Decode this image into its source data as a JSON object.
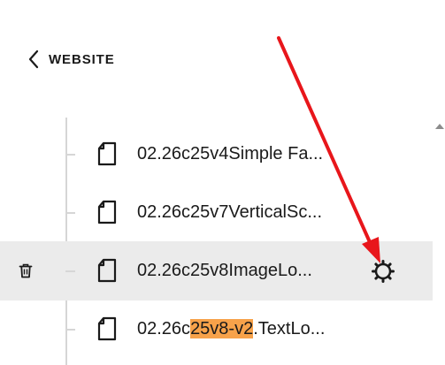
{
  "header": {
    "back_label": "WEBSITE"
  },
  "pages": [
    {
      "prefix": "02.26c25v4Simple Fa...",
      "highlight": "",
      "suffix": ""
    },
    {
      "prefix": "02.26c25v7VerticalSc...",
      "highlight": "",
      "suffix": ""
    },
    {
      "prefix": "02.26c25v8ImageLo...",
      "highlight": "",
      "suffix": ""
    },
    {
      "prefix": "02.26c",
      "highlight": "25v8-v2",
      "suffix": ".TextLo..."
    }
  ],
  "selected_row_index": 2,
  "colors": {
    "selected_row_bg": "#ebebeb",
    "search_highlight": "#f7a24a",
    "annotation_arrow": "#e8161b"
  },
  "icons": {
    "back": "chevron-left-icon",
    "page": "page-icon",
    "delete": "trash-icon",
    "settings": "gear-icon"
  }
}
